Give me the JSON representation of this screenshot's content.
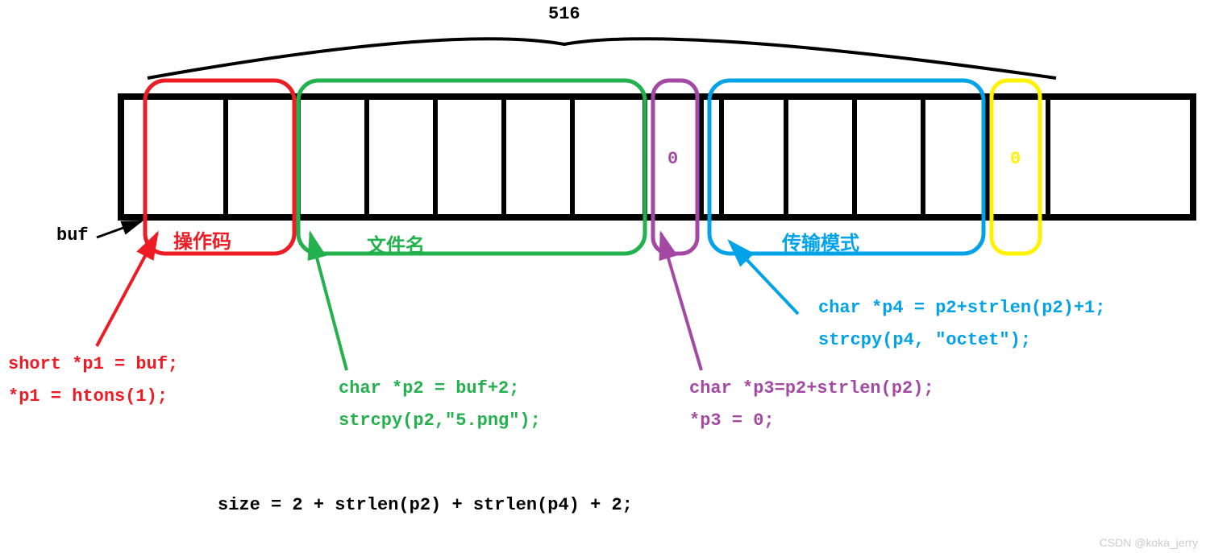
{
  "top_width": "516",
  "buf_label": "buf",
  "sections": {
    "opcode": {
      "label": "操作码",
      "code1": "short *p1 = buf;",
      "code2": "*p1 = htons(1);"
    },
    "filename": {
      "label": "文件名",
      "code1": "char *p2 = buf+2;",
      "code2": "strcpy(p2,\"5.png\");"
    },
    "zero1": {
      "value": "0",
      "code1": "char *p3=p2+strlen(p2);",
      "code2": "*p3 = 0;"
    },
    "mode": {
      "label": "传输模式",
      "code1": "char *p4 = p2+strlen(p2)+1;",
      "code2": "strcpy(p4, \"octet\");"
    },
    "zero2": {
      "value": "0"
    }
  },
  "size_formula": "size = 2 + strlen(p2) + strlen(p4) + 2;",
  "watermark": "CSDN @koka_jerry",
  "colors": {
    "red": "#ed1c24",
    "green": "#22b14c",
    "purple": "#a349a4",
    "blue": "#00a2e8",
    "yellow": "#fff200",
    "black": "#000000"
  }
}
